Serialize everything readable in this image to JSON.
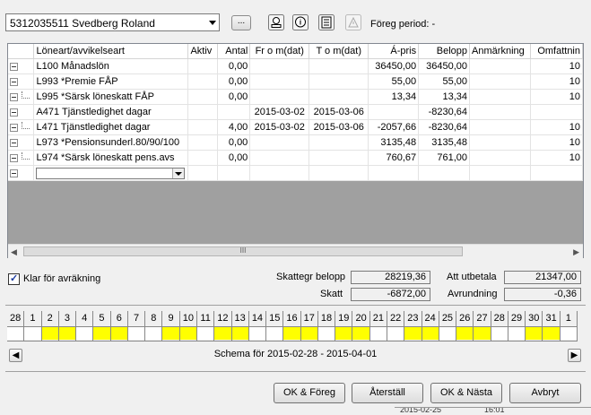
{
  "header": {
    "employee": "5312035511   Svedberg Roland",
    "browse_label": "...",
    "previous_period": "Föreg period: -"
  },
  "grid": {
    "columns": [
      "",
      "Löneart/avvikelseart",
      "Aktiv",
      "Antal",
      "Fr o m(dat)",
      "T o m(dat)",
      "Á-pris",
      "Belopp",
      "Anmärkning",
      "Omfattnin"
    ],
    "rows": [
      {
        "tree": "box",
        "name": "L100 Månadslön",
        "aktiv": "",
        "antal": "0,00",
        "from": "",
        "tom": "",
        "apris": "36450,00",
        "belopp": "36450,00",
        "anm": "",
        "omf": "10"
      },
      {
        "tree": "box",
        "name": "L993 *Premie FÅP",
        "aktiv": "",
        "antal": "0,00",
        "from": "",
        "tom": "",
        "apris": "55,00",
        "belopp": "55,00",
        "anm": "",
        "omf": "10"
      },
      {
        "tree": "sub",
        "name": "L995 *Särsk löneskatt FÅP",
        "aktiv": "",
        "antal": "0,00",
        "from": "",
        "tom": "",
        "apris": "13,34",
        "belopp": "13,34",
        "anm": "",
        "omf": "10"
      },
      {
        "tree": "box",
        "name": "A471 Tjänstledighet dagar",
        "aktiv": "",
        "antal": "",
        "from": "2015-03-02",
        "tom": "2015-03-06",
        "apris": "",
        "belopp": "-8230,64",
        "anm": "",
        "omf": ""
      },
      {
        "tree": "sub",
        "name": "L471 Tjänstledighet dagar",
        "aktiv": "",
        "antal": "4,00",
        "from": "2015-03-02",
        "tom": "2015-03-06",
        "apris": "-2057,66",
        "belopp": "-8230,64",
        "anm": "",
        "omf": "10"
      },
      {
        "tree": "box",
        "name": "L973 *Pensionsunderl.80/90/100",
        "aktiv": "",
        "antal": "0,00",
        "from": "",
        "tom": "",
        "apris": "3135,48",
        "belopp": "3135,48",
        "anm": "",
        "omf": "10"
      },
      {
        "tree": "sub",
        "name": "L974 *Särsk löneskatt pens.avs",
        "aktiv": "",
        "antal": "0,00",
        "from": "",
        "tom": "",
        "apris": "760,67",
        "belopp": "761,00",
        "anm": "",
        "omf": "10"
      }
    ]
  },
  "summary": {
    "ready_label": "Klar för avräkning",
    "skattegr_label": "Skattegr belopp",
    "skattegr_value": "28219,36",
    "skatt_label": "Skatt",
    "skatt_value": "-6872,00",
    "att_utbetala_label": "Att utbetala",
    "att_utbetala_value": "21347,00",
    "avrundning_label": "Avrundning",
    "avrundning_value": "-0,36"
  },
  "calendar": {
    "days": [
      {
        "n": "28",
        "y": false
      },
      {
        "n": "1",
        "y": false
      },
      {
        "n": "2",
        "y": true
      },
      {
        "n": "3",
        "y": true
      },
      {
        "n": "4",
        "y": false
      },
      {
        "n": "5",
        "y": true
      },
      {
        "n": "6",
        "y": true
      },
      {
        "n": "7",
        "y": false
      },
      {
        "n": "8",
        "y": false
      },
      {
        "n": "9",
        "y": true
      },
      {
        "n": "10",
        "y": true
      },
      {
        "n": "11",
        "y": false
      },
      {
        "n": "12",
        "y": true
      },
      {
        "n": "13",
        "y": true
      },
      {
        "n": "14",
        "y": false
      },
      {
        "n": "15",
        "y": false
      },
      {
        "n": "16",
        "y": true
      },
      {
        "n": "17",
        "y": true
      },
      {
        "n": "18",
        "y": false
      },
      {
        "n": "19",
        "y": true
      },
      {
        "n": "20",
        "y": true
      },
      {
        "n": "21",
        "y": false
      },
      {
        "n": "22",
        "y": false
      },
      {
        "n": "23",
        "y": true
      },
      {
        "n": "24",
        "y": true
      },
      {
        "n": "25",
        "y": false
      },
      {
        "n": "26",
        "y": true
      },
      {
        "n": "27",
        "y": true
      },
      {
        "n": "28",
        "y": false
      },
      {
        "n": "29",
        "y": false
      },
      {
        "n": "30",
        "y": true
      },
      {
        "n": "31",
        "y": true
      },
      {
        "n": "1",
        "y": false
      }
    ],
    "schema_text": "Schema för 2015-02-28 - 2015-04-01",
    "highlight_color": "#ffff00"
  },
  "buttons": {
    "ok_foreg": "OK & Föreg",
    "aterstall": "Återställ",
    "ok_nasta": "OK & Nästa",
    "avbryt": "Avbryt"
  },
  "status": {
    "date": "2015-02-25",
    "time": "16:01"
  }
}
